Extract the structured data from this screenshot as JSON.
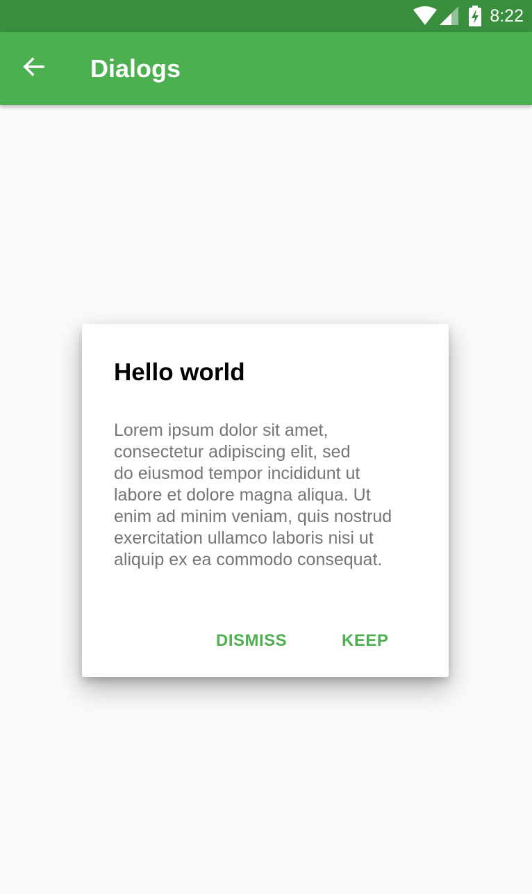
{
  "status_bar": {
    "time": "8:22",
    "icons": [
      "wifi-icon",
      "cell-signal-icon",
      "battery-charging-icon"
    ]
  },
  "app_bar": {
    "title": "Dialogs",
    "back_icon": "arrow-back-icon",
    "color": "#4caf50"
  },
  "dialog": {
    "title": "Hello world",
    "body_lines": [
      "Lorem ipsum dolor sit amet,",
      "consectetur adipiscing elit, sed",
      "do eiusmod tempor incididunt ut",
      "labore et dolore magna aliqua. Ut",
      "enim ad minim veniam, quis nostrud",
      "exercitation ullamco laboris nisi ut",
      "aliquip ex ea commodo consequat."
    ],
    "dismiss_label": "DISMISS",
    "keep_label": "KEEP",
    "accent_color": "#4caf50"
  },
  "colors": {
    "status_bar": "#388e3c",
    "background": "#fafafa",
    "body_text": "#757575"
  }
}
